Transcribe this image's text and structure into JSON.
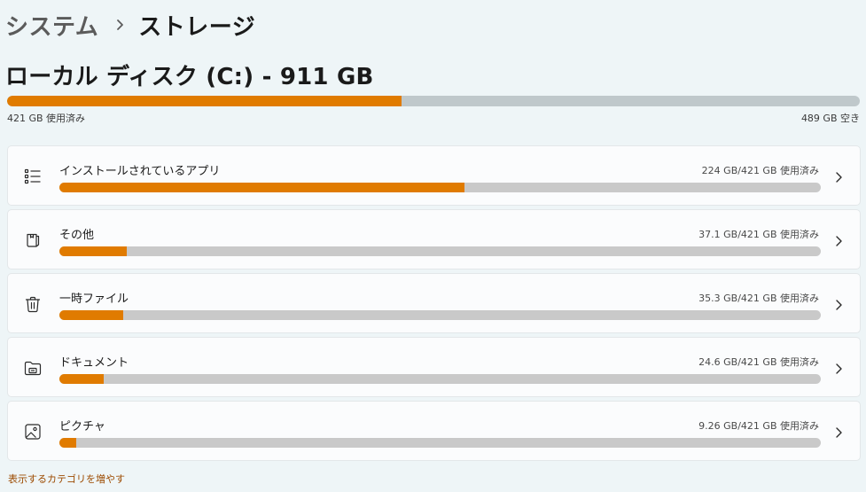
{
  "breadcrumb": {
    "parent": "システム",
    "current": "ストレージ"
  },
  "disk": {
    "title": "ローカル ディスク (C:) - 911 GB",
    "used_text": "421 GB 使用済み",
    "free_text": "489 GB 空き",
    "used_fraction": 0.4622
  },
  "categories": [
    {
      "label": "インストールされているアプリ",
      "usage": "224 GB/421 GB 使用済み",
      "fraction": 0.532,
      "icon": "list-icon"
    },
    {
      "label": "その他",
      "usage": "37.1 GB/421 GB 使用済み",
      "fraction": 0.0881,
      "icon": "document-stack-icon"
    },
    {
      "label": "一時ファイル",
      "usage": "35.3 GB/421 GB 使用済み",
      "fraction": 0.0838,
      "icon": "trash-icon"
    },
    {
      "label": "ドキュメント",
      "usage": "24.6 GB/421 GB 使用済み",
      "fraction": 0.0584,
      "icon": "folder-icon"
    },
    {
      "label": "ピクチャ",
      "usage": "9.26 GB/421 GB 使用済み",
      "fraction": 0.022,
      "icon": "image-icon"
    }
  ],
  "more_link": "表示するカテゴリを増やす",
  "colors": {
    "accent": "#e07b00",
    "track_disk": "#bfc8cb",
    "track_category": "#c9c9c9",
    "link": "#9c4a00"
  }
}
